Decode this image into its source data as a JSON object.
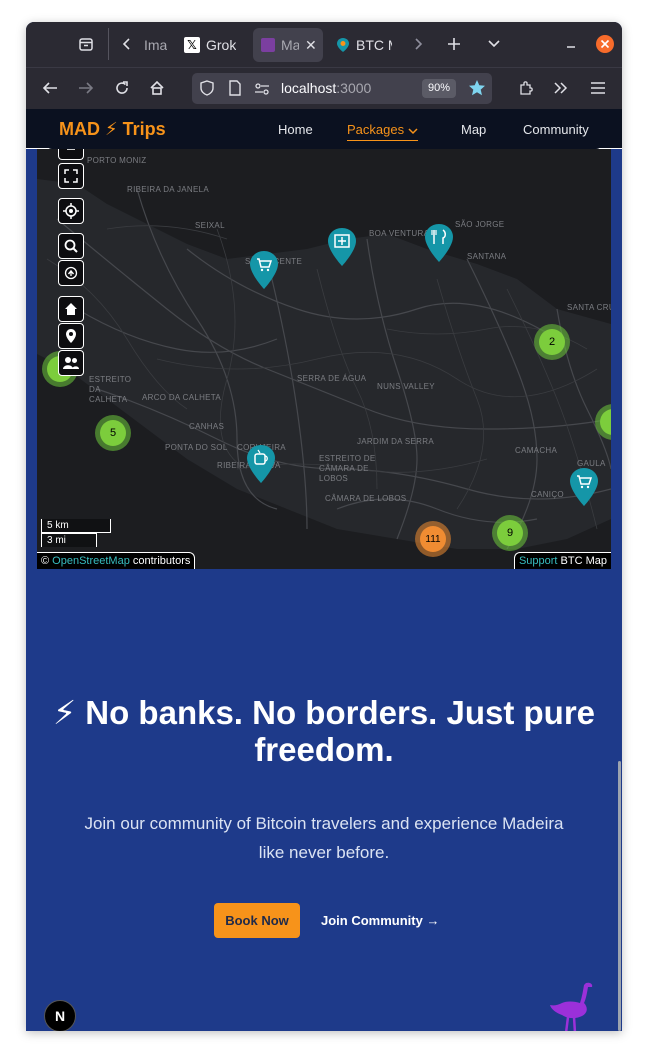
{
  "browser": {
    "tabs": [
      {
        "label": "Ima"
      },
      {
        "label": "Grok"
      },
      {
        "label": "Ma"
      },
      {
        "label": "BTC M"
      }
    ],
    "url_host": "localhost",
    "url_port": ":3000",
    "zoom": "90%"
  },
  "site": {
    "brand": "MAD ⚡ Trips",
    "nav": [
      {
        "label": "Home"
      },
      {
        "label": "Packages"
      },
      {
        "label": "Map"
      },
      {
        "label": "Community"
      }
    ]
  },
  "map": {
    "places": [
      "PORTO MONIZ",
      "RIBEIRA DA JANELA",
      "SEIXAL",
      "SÃO VICENTE",
      "BOA VENTURA",
      "SÃO JORGE",
      "SANTANA",
      "ESTREITO DA CALHETA",
      "ARCO DA CALHETA",
      "SERRA DE ÁGUA",
      "NUNS VALLEY",
      "CANHAS",
      "PONTA DO SOL",
      "CORUJEIRA",
      "JARDIM DA SERRA",
      "RIBEIRA BRAVA",
      "ESTREITO DE CÂMARA DE LOBOS",
      "CÂMARA DE LOBOS",
      "CAMACHA",
      "SANTA CRUZ",
      "GAULA",
      "CANIÇO"
    ],
    "clusters": [
      {
        "count": "2"
      },
      {
        "count": "5"
      },
      {
        "count": "111"
      },
      {
        "count": "9"
      }
    ],
    "scale_km": "5 km",
    "scale_mi": "3 mi",
    "attribution_prefix": "©",
    "attribution_link": "OpenStreetMap",
    "attribution_suffix": "contributors",
    "support_link": "Support",
    "support_suffix": "BTC Map",
    "pin_color": "#1596a8",
    "cluster_green": "#7ccd3c",
    "cluster_orange": "#f08c32"
  },
  "hero": {
    "title": "⚡ No banks. No borders. Just pure freedom.",
    "subtitle": "Join our community of Bitcoin travelers and experience Madeira like never before.",
    "book_label": "Book Now",
    "join_label": "Join Community →"
  },
  "next_badge": "N",
  "colors": {
    "bitcoin_orange": "#f7931a",
    "page_blue": "#1e3a8a",
    "nav_dark": "#0b1120"
  }
}
